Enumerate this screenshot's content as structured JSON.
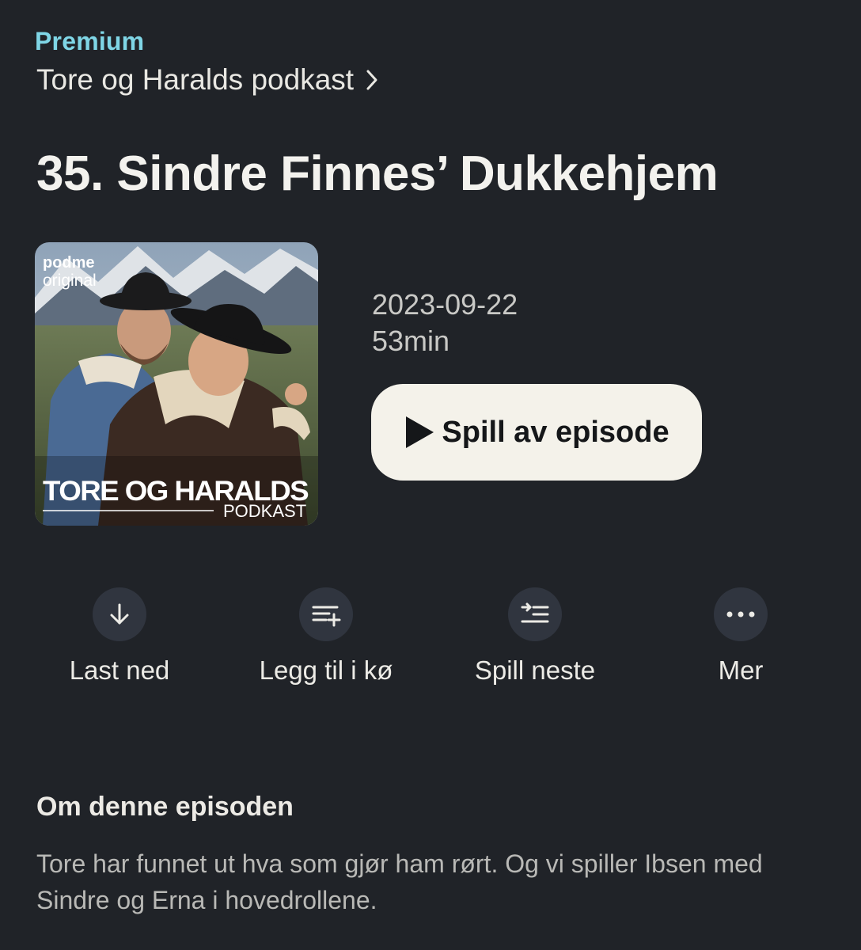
{
  "header": {
    "badge": "Premium",
    "podcast_name": "Tore og Haralds podkast"
  },
  "episode": {
    "title": "35. Sindre Finnes’ Dukkehjem",
    "date": "2023-09-22",
    "duration": "53min",
    "play_label": "Spill av episode"
  },
  "cover": {
    "brand_top": "podme",
    "brand_bottom": "original",
    "show_title": "TORE OG HARALDS",
    "show_subtitle": "PODKAST"
  },
  "actions": [
    {
      "label": "Last ned",
      "icon": "download-icon"
    },
    {
      "label": "Legg til i kø",
      "icon": "add-to-queue-icon"
    },
    {
      "label": "Spill neste",
      "icon": "play-next-icon"
    },
    {
      "label": "Mer",
      "icon": "more-icon"
    }
  ],
  "about": {
    "heading": "Om denne episoden",
    "text": "Tore har funnet ut hva som gjør ham rørt. Og vi spiller Ibsen med Sindre og Erna i hovedrollene."
  },
  "colors": {
    "background": "#202328",
    "accent": "#7fd6e6",
    "button": "#f4f2ea",
    "icon_circle": "#30353f"
  }
}
